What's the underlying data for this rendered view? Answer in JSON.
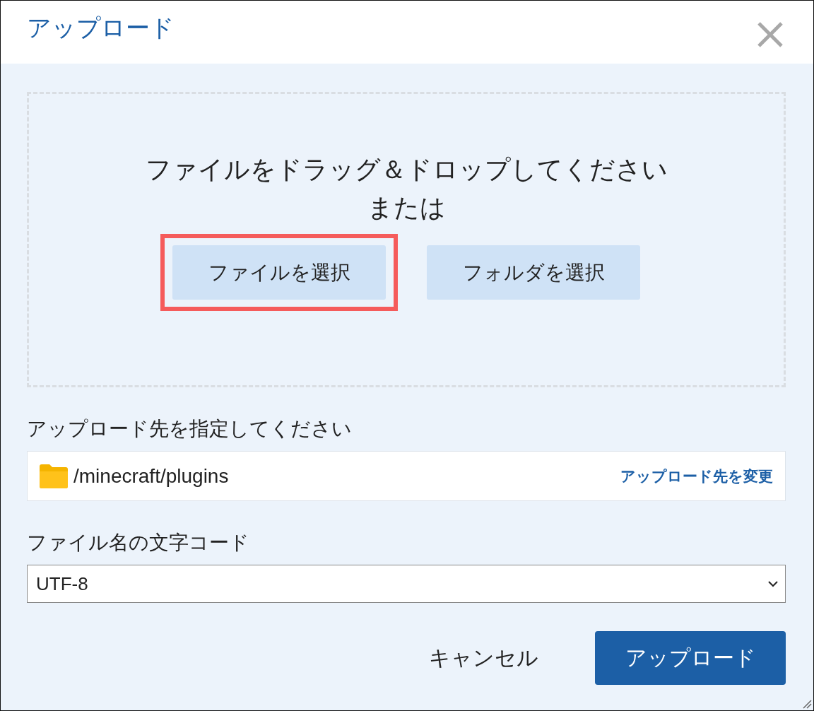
{
  "dialog": {
    "title": "アップロード"
  },
  "drop_zone": {
    "lines": [
      "ファイルをドラッグ＆ドロップしてください",
      "または"
    ],
    "buttons": [
      {
        "label": "ファイルを選択",
        "highlighted": true
      },
      {
        "label": "フォルダを選択",
        "highlighted": false
      }
    ]
  },
  "destination": {
    "label": "アップロード先を指定してください",
    "path": "/minecraft/plugins",
    "change_link": "アップロード先を変更"
  },
  "encoding": {
    "label": "ファイル名の文字コード",
    "value": "UTF-8"
  },
  "actions": [
    {
      "label": "キャンセル",
      "kind": "text"
    },
    {
      "label": "アップロード",
      "kind": "primary"
    }
  ]
}
